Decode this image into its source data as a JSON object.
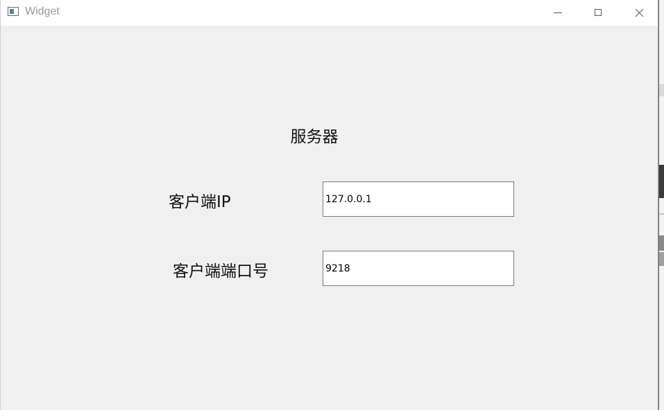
{
  "window": {
    "title": "Widget"
  },
  "titlebar_buttons": {
    "minimize": "minimize",
    "maximize": "maximize",
    "close": "close"
  },
  "form": {
    "heading": "服务器",
    "client_ip_label": "客户端IP",
    "client_ip_value": "127.0.0.1",
    "client_port_label": "客户端端口号",
    "client_port_value": "9218"
  },
  "colors": {
    "window_bg": "#f0f0f0",
    "titlebar_bg": "#ffffff",
    "title_text": "#9a9a9a"
  }
}
